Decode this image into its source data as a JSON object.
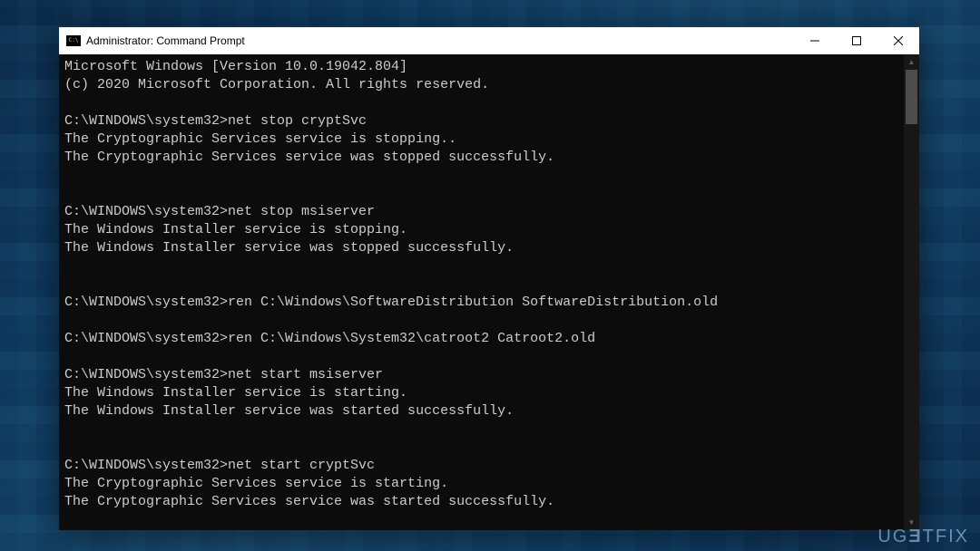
{
  "window": {
    "title": "Administrator: Command Prompt"
  },
  "terminal": {
    "lines": [
      "Microsoft Windows [Version 10.0.19042.804]",
      "(c) 2020 Microsoft Corporation. All rights reserved.",
      "",
      "C:\\WINDOWS\\system32>net stop cryptSvc",
      "The Cryptographic Services service is stopping..",
      "The Cryptographic Services service was stopped successfully.",
      "",
      "",
      "C:\\WINDOWS\\system32>net stop msiserver",
      "The Windows Installer service is stopping.",
      "The Windows Installer service was stopped successfully.",
      "",
      "",
      "C:\\WINDOWS\\system32>ren C:\\Windows\\SoftwareDistribution SoftwareDistribution.old",
      "",
      "C:\\WINDOWS\\system32>ren C:\\Windows\\System32\\catroot2 Catroot2.old",
      "",
      "C:\\WINDOWS\\system32>net start msiserver",
      "The Windows Installer service is starting.",
      "The Windows Installer service was started successfully.",
      "",
      "",
      "C:\\WINDOWS\\system32>net start cryptSvc",
      "The Cryptographic Services service is starting.",
      "The Cryptographic Services service was started successfully."
    ]
  },
  "watermark": {
    "text_prefix": "UG",
    "text_e": "Ǝ",
    "text_suffix": "TFIX"
  }
}
